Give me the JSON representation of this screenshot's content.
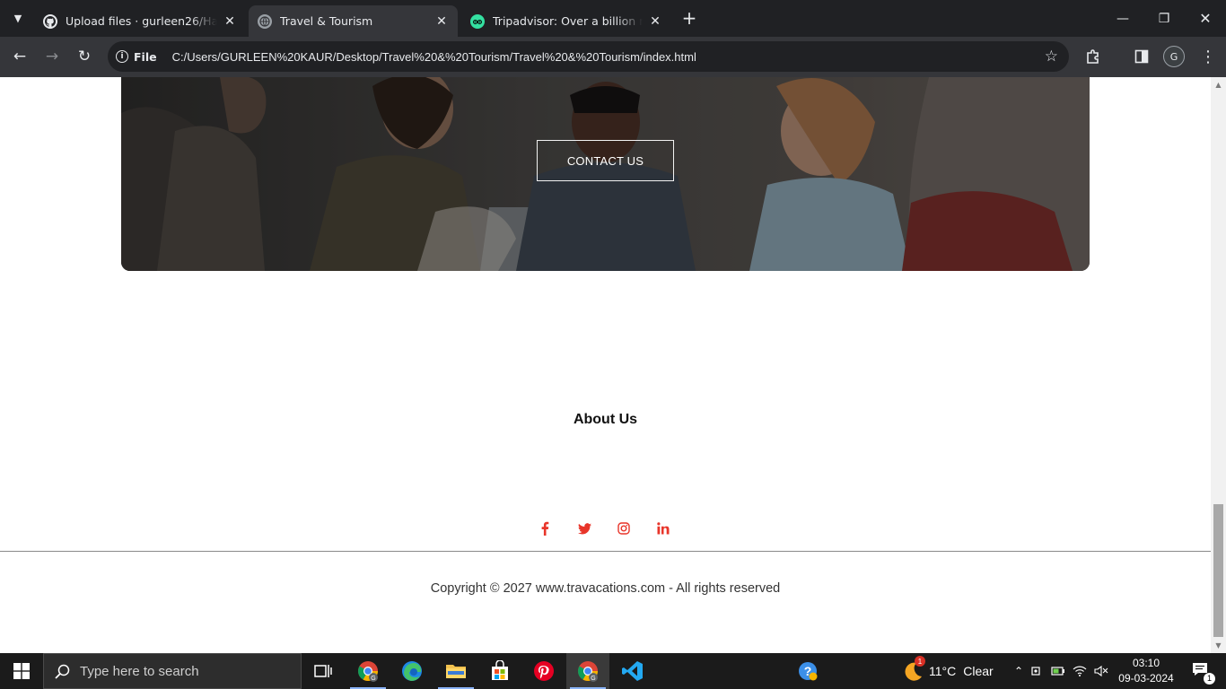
{
  "browser": {
    "tabs": [
      {
        "title": "Upload files · gurleen26/Hackathon",
        "icon": "github-icon",
        "active": false
      },
      {
        "title": "Travel & Tourism",
        "icon": "globe-icon",
        "active": true
      },
      {
        "title": "Tripadvisor: Over a billion reviews",
        "icon": "tripadvisor-icon",
        "active": false
      }
    ],
    "new_tab_label": "+",
    "address": {
      "chip_label": "File",
      "url": "C:/Users/GURLEEN%20KAUR/Desktop/Travel%20&%20Tourism/Travel%20&%20Tourism/index.html"
    },
    "profile_initial": "G"
  },
  "page": {
    "hero": {
      "cta_label": "CONTACT US"
    },
    "about": {
      "title": "About Us"
    },
    "social_links": [
      {
        "name": "facebook-icon"
      },
      {
        "name": "twitter-icon"
      },
      {
        "name": "instagram-icon"
      },
      {
        "name": "linkedin-icon"
      }
    ],
    "footer": {
      "copyright": "Copyright © 2027 www.travacations.com - All rights reserved"
    },
    "accent_color": "#e8352a"
  },
  "taskbar": {
    "search_placeholder": "Type here to search",
    "weather": {
      "temp": "11°C",
      "condition": "Clear",
      "badge": "1"
    },
    "clock": {
      "time": "03:10",
      "date": "09-03-2024"
    },
    "notification_count": "1"
  }
}
